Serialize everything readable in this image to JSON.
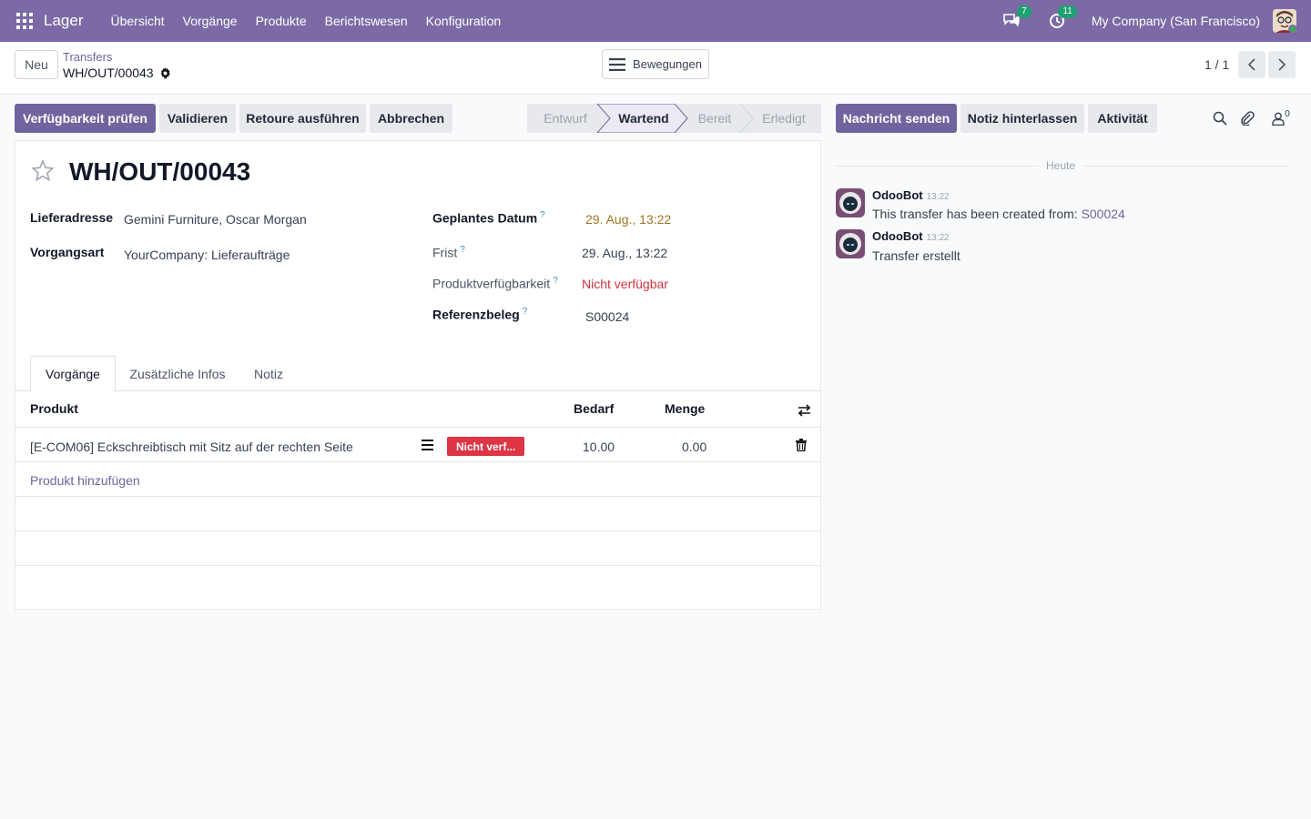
{
  "navbar": {
    "app_name": "Lager",
    "menu": [
      "Übersicht",
      "Vorgänge",
      "Produkte",
      "Berichtswesen",
      "Konfiguration"
    ],
    "messages_badge": "7",
    "activities_badge": "11",
    "company": "My Company (San Francisco)",
    "colors": {
      "brand": "#7c6aa6",
      "badge": "#1ea170"
    }
  },
  "control": {
    "new_label": "Neu",
    "breadcrumb_parent": "Transfers",
    "breadcrumb_current": "WH/OUT/00043",
    "moves_label": "Bewegungen",
    "pager": "1 / 1"
  },
  "actions": {
    "check_availability": "Verfügbarkeit prüfen",
    "validate": "Validieren",
    "return": "Retoure ausführen",
    "cancel": "Abbrechen"
  },
  "status": {
    "steps": [
      "Entwurf",
      "Wartend",
      "Bereit",
      "Erledigt"
    ],
    "active": "Wartend"
  },
  "form": {
    "title": "WH/OUT/00043",
    "delivery_address_label": "Lieferadresse",
    "delivery_address_value": "Gemini Furniture, Oscar Morgan",
    "operation_type_label": "Vorgangsart",
    "operation_type_value": "YourCompany: Lieferaufträge",
    "scheduled_date_label": "Geplantes Datum",
    "scheduled_date_value": "29. Aug., 13:22",
    "deadline_label": "Frist",
    "deadline_value": "29. Aug., 13:22",
    "availability_label": "Produktverfügbarkeit",
    "availability_value": "Nicht verfügbar",
    "source_doc_label": "Referenzbeleg",
    "source_doc_value": "S00024",
    "help_mark": "?"
  },
  "tabs": [
    "Vorgänge",
    "Zusätzliche Infos",
    "Notiz"
  ],
  "table": {
    "headers": {
      "product": "Produkt",
      "demand": "Bedarf",
      "quantity": "Menge"
    },
    "rows": [
      {
        "product": "[E-COM06] Eckschreibtisch mit Sitz auf der rechten Seite",
        "badge": "Nicht verf...",
        "demand": "10.00",
        "quantity": "0.00"
      }
    ],
    "add_line": "Produkt hinzufügen"
  },
  "chatter": {
    "send_message": "Nachricht senden",
    "log_note": "Notiz hinterlassen",
    "activities": "Aktivität",
    "followers_count": "0",
    "date_separator": "Heute",
    "messages": [
      {
        "author": "OdooBot",
        "time": "13:22",
        "text": "This transfer has been created from: ",
        "link": "S00024"
      },
      {
        "author": "OdooBot",
        "time": "13:22",
        "text": "Transfer erstellt"
      }
    ]
  }
}
